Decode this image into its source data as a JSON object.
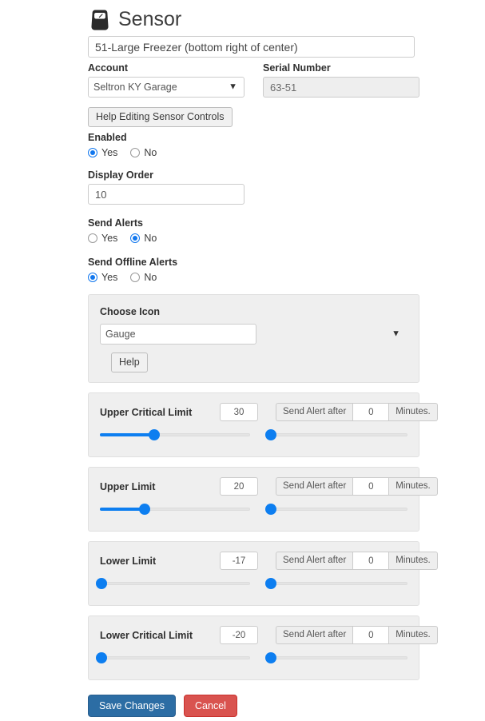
{
  "header": {
    "icon": "scale-gauge-icon",
    "title": "Sensor"
  },
  "form": {
    "sensor_name_value": "51-Large Freezer (bottom right of center)",
    "account_label": "Account",
    "account_value": "Seltron KY Garage",
    "serial_label": "Serial Number",
    "serial_value": "63-51",
    "help_editing_button": "Help Editing Sensor Controls",
    "enabled_label": "Enabled",
    "enabled_yes": "Yes",
    "enabled_no": "No",
    "enabled_selected": "Yes",
    "display_order_label": "Display Order",
    "display_order_value": "10",
    "send_alerts_label": "Send Alerts",
    "send_alerts_yes": "Yes",
    "send_alerts_no": "No",
    "send_alerts_selected": "No",
    "send_offline_alerts_label": "Send Offline Alerts",
    "send_offline_alerts_yes": "Yes",
    "send_offline_alerts_no": "No",
    "send_offline_alerts_selected": "Yes"
  },
  "choose_icon": {
    "label": "Choose Icon",
    "selected": "Gauge",
    "help_button": "Help"
  },
  "limits": [
    {
      "name": "Upper Critical Limit",
      "value": "30",
      "alert_prefix": "Send Alert after",
      "alert_value": "0",
      "alert_suffix": "Minutes.",
      "slider_percent": 36,
      "alert_slider_percent": 2
    },
    {
      "name": "Upper Limit",
      "value": "20",
      "alert_prefix": "Send Alert after",
      "alert_value": "0",
      "alert_suffix": "Minutes.",
      "slider_percent": 30,
      "alert_slider_percent": 2
    },
    {
      "name": "Lower Limit",
      "value": "-17",
      "alert_prefix": "Send Alert after",
      "alert_value": "0",
      "alert_suffix": "Minutes.",
      "slider_percent": 1,
      "alert_slider_percent": 2
    },
    {
      "name": "Lower Critical Limit",
      "value": "-20",
      "alert_prefix": "Send Alert after",
      "alert_value": "0",
      "alert_suffix": "Minutes.",
      "slider_percent": 1,
      "alert_slider_percent": 2
    }
  ],
  "footer": {
    "save_label": "Save Changes",
    "cancel_label": "Cancel"
  },
  "colors": {
    "primary_button": "#2c6da4",
    "danger_button": "#d9534f",
    "slider_blue": "#0d7ef0",
    "panel_bg": "#efefef"
  }
}
